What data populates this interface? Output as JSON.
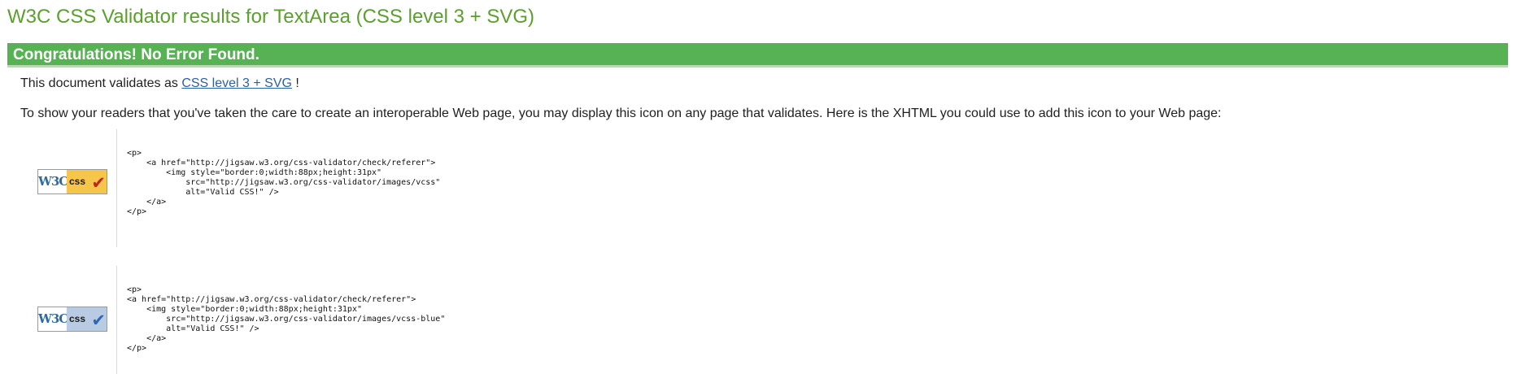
{
  "title": "W3C CSS Validator results for TextArea (CSS level 3 + SVG)",
  "status": {
    "message": "Congratulations! No Error Found."
  },
  "validates": {
    "prefix": "This document validates as",
    "link_text": "CSS level 3 + SVG",
    "suffix": "!"
  },
  "info_text": "To show your readers that you've taken the care to create an interoperable Web page, you may display this icon on any page that validates. Here is the XHTML you could use to add this icon to your Web page:",
  "badges": [
    {
      "w3c_text": "W3C",
      "css_text": "css",
      "icon": "check-icon",
      "code": "<p>\n    <a href=\"http://jigsaw.w3.org/css-validator/check/referer\">\n        <img style=\"border:0;width:88px;height:31px\"\n            src=\"http://jigsaw.w3.org/css-validator/images/vcss\"\n            alt=\"Valid CSS!\" />\n    </a>\n</p>"
    },
    {
      "w3c_text": "W3C",
      "css_text": "css",
      "icon": "check-icon",
      "code": "<p>\n<a href=\"http://jigsaw.w3.org/css-validator/check/referer\">\n    <img style=\"border:0;width:88px;height:31px\"\n        src=\"http://jigsaw.w3.org/css-validator/images/vcss-blue\"\n        alt=\"Valid CSS!\" />\n    </a>\n</p>"
    }
  ],
  "colors": {
    "title": "#5aa02c",
    "success_background": "#57b254",
    "success_text": "#ffffff",
    "link": "#2b61a8",
    "badge_yellow": "#f6c64b",
    "badge_blue": "#b9cbe3",
    "check_red": "#c5221f",
    "check_blue": "#2d69b2"
  }
}
